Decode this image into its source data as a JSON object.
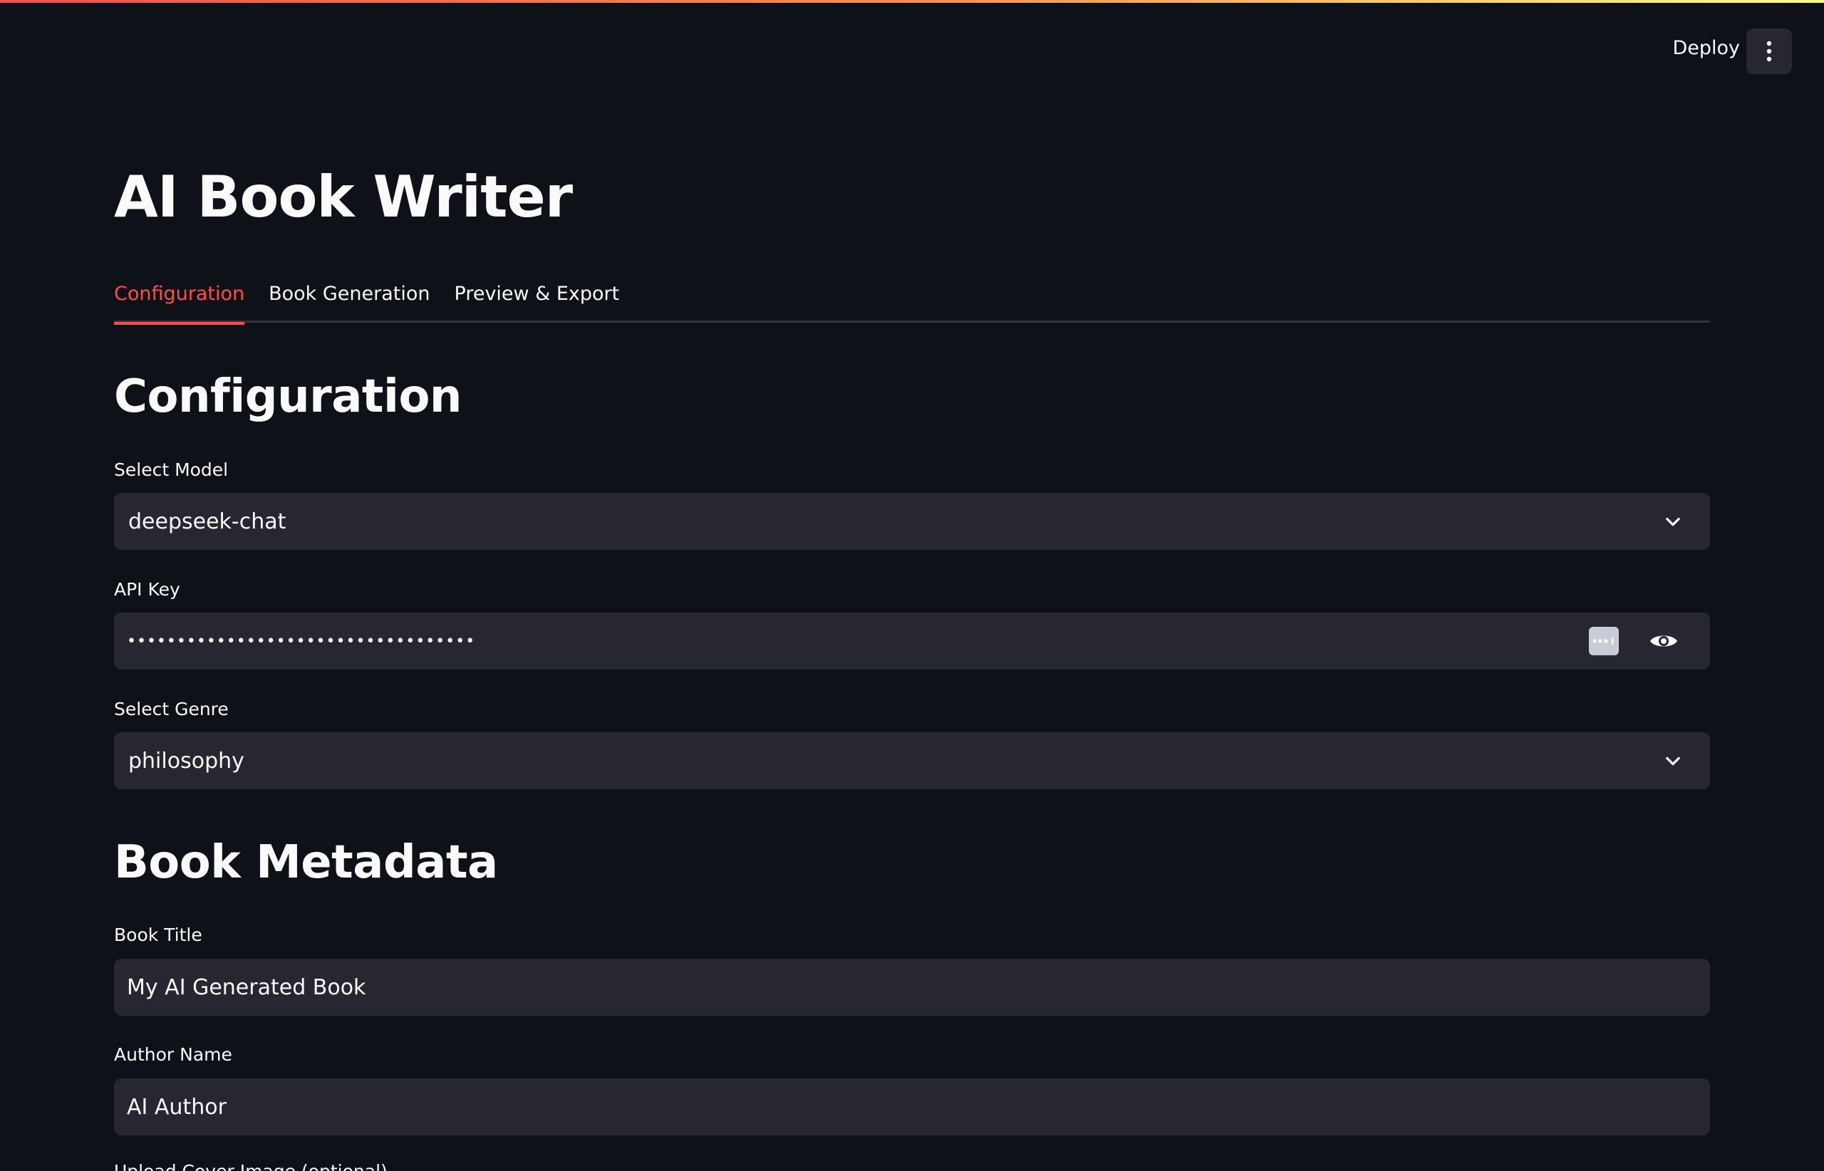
{
  "header": {
    "deploy_label": "Deploy"
  },
  "app": {
    "title": "AI Book Writer"
  },
  "tabs": [
    {
      "label": "Configuration",
      "active": true
    },
    {
      "label": "Book Generation",
      "active": false
    },
    {
      "label": "Preview & Export",
      "active": false
    }
  ],
  "configuration": {
    "heading": "Configuration",
    "model": {
      "label": "Select Model",
      "value": "deepseek-chat"
    },
    "api_key": {
      "label": "API Key",
      "value": "•••••••••••••••••••••••••••••••••••"
    },
    "genre": {
      "label": "Select Genre",
      "value": "philosophy"
    }
  },
  "metadata": {
    "heading": "Book Metadata",
    "book_title": {
      "label": "Book Title",
      "value": "My AI Generated Book"
    },
    "author_name": {
      "label": "Author Name",
      "value": "AI Author"
    },
    "cover_upload": {
      "label": "Upload Cover Image (optional)"
    }
  },
  "colors": {
    "background": "#0e1117",
    "field": "#262730",
    "accent": "#ff4b4b"
  }
}
